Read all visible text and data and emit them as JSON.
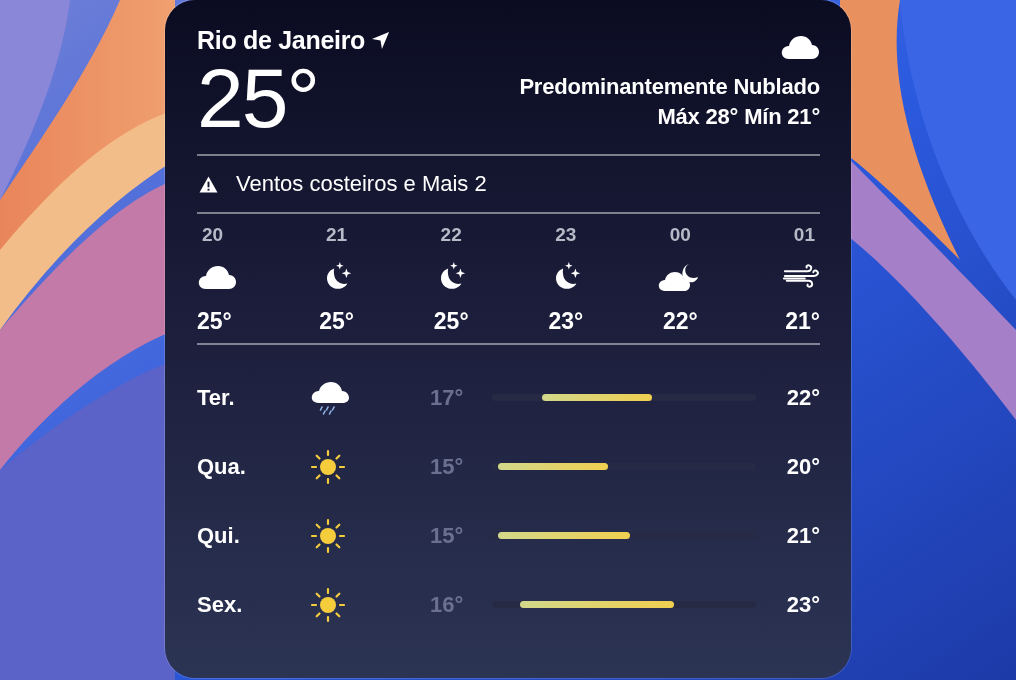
{
  "widget": {
    "city": "Rio de Janeiro",
    "condition_icon": {
      "kind": "cloud"
    },
    "temperature": "25°",
    "condition": "Predominantemente Nublado",
    "high_low": "Máx 28° Mín 21°",
    "alert": "Ventos costeiros e Mais 2",
    "hourly": [
      {
        "time": "20",
        "kind": "cloud",
        "temp": "25°"
      },
      {
        "time": "21",
        "kind": "moon",
        "temp": "25°"
      },
      {
        "time": "22",
        "kind": "moon",
        "temp": "25°"
      },
      {
        "time": "23",
        "kind": "moon",
        "temp": "23°"
      },
      {
        "time": "00",
        "kind": "cloud-moon",
        "temp": "22°"
      },
      {
        "time": "01",
        "kind": "wind",
        "temp": "21°"
      }
    ],
    "daily": [
      {
        "day": "Ter.",
        "kind": "rain",
        "low": "17°",
        "high": "22°"
      },
      {
        "day": "Qua.",
        "kind": "sun",
        "low": "15°",
        "high": "20°"
      },
      {
        "day": "Qui.",
        "kind": "sun",
        "low": "15°",
        "high": "21°"
      },
      {
        "day": "Sex.",
        "kind": "sun",
        "low": "16°",
        "high": "23°"
      }
    ]
  }
}
